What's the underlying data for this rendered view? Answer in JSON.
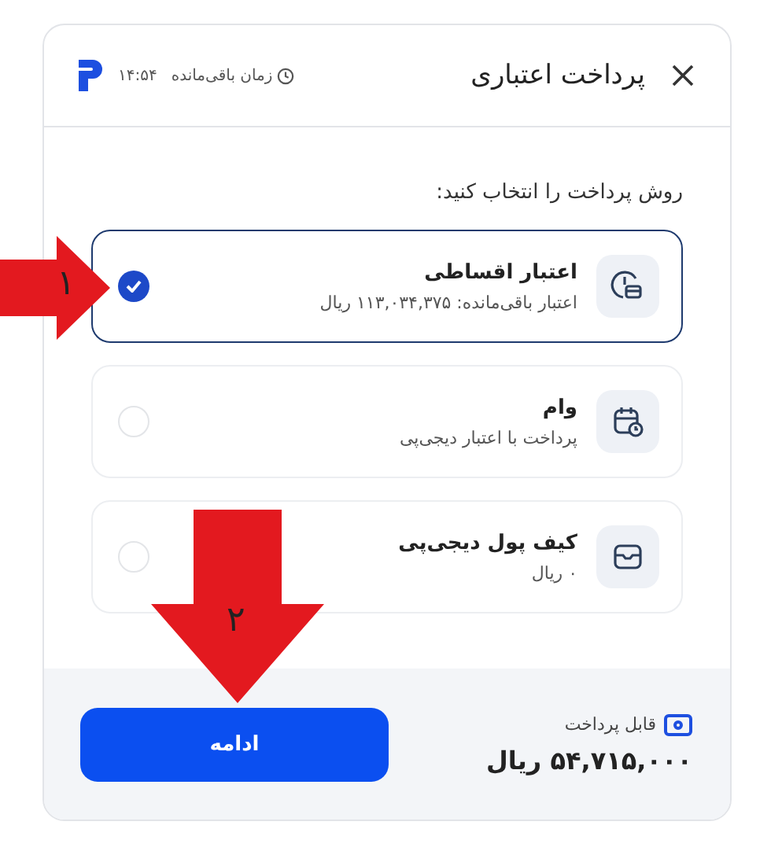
{
  "header": {
    "title": "پرداخت اعتباری",
    "timer_label": "زمان باقی‌مانده",
    "timer_value": "۱۴:۵۴"
  },
  "prompt": "روش پرداخت را انتخاب کنید:",
  "options": [
    {
      "kind": "installment",
      "title": "اعتبار اقساطی",
      "subtitle": "اعتبار باقی‌مانده: ۱۱۳,۰۳۴,۳۷۵ ریال",
      "selected": true
    },
    {
      "kind": "loan",
      "title": "وام",
      "subtitle": "پرداخت با اعتبار دیجی‌پی",
      "selected": false
    },
    {
      "kind": "wallet",
      "title": "کیف پول دیجی‌پی",
      "subtitle": "۰ ریال",
      "selected": false
    }
  ],
  "footer": {
    "payable_label": "قابل پرداخت",
    "amount": "۵۴,۷۱۵,۰۰۰ ریال",
    "button": "ادامه"
  },
  "annotations": [
    {
      "kind": "right",
      "label": "۱"
    },
    {
      "kind": "down",
      "label": "۲"
    }
  ]
}
